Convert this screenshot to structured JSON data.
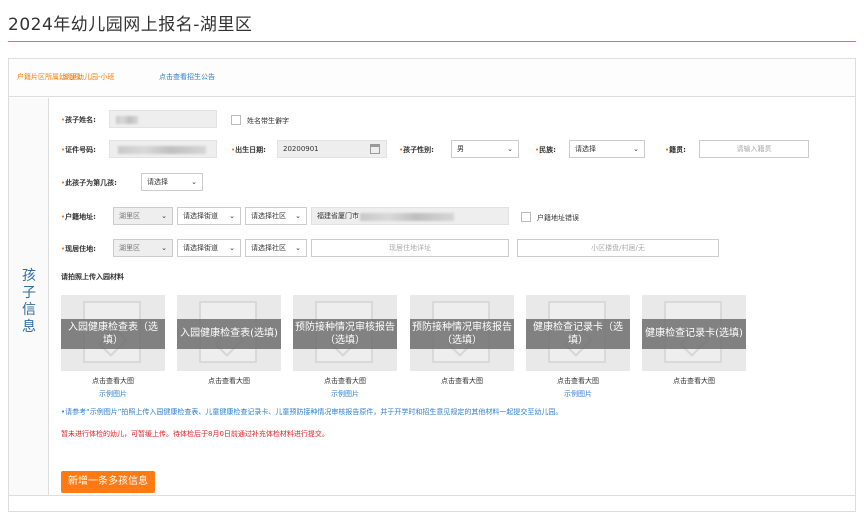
{
  "page": {
    "title": "2024年幼儿园网上报名-湖里区"
  },
  "notice": {
    "kindergarten_label": "户籍片区所属幼儿园:",
    "kindergarten_value": "湖里幼儿园-小班",
    "announcement_link": "点击查看招生公告"
  },
  "section": {
    "title_chars": [
      "孩",
      "子",
      "信",
      "息"
    ]
  },
  "form": {
    "child_name": {
      "label": "孩子姓名:"
    },
    "rare_char": {
      "label": "姓名带生僻字"
    },
    "id_number": {
      "label": "证件号码:"
    },
    "birth": {
      "label": "出生日期:",
      "value": "20200901"
    },
    "gender": {
      "label": "孩子性别:",
      "value": "男"
    },
    "ethnicity": {
      "label": "民族:",
      "value": "请选择"
    },
    "native_place": {
      "label": "籍贯:",
      "placeholder": "请输入籍贯"
    },
    "child_order": {
      "label": "此孩子为第几孩:",
      "value": "请选择"
    },
    "household": {
      "label": "户籍地址:",
      "district": "湖里区",
      "street": "请选择街道",
      "community": "请选择社区",
      "address_prefix": "福建省厦门市",
      "error_label": "户籍地址错误"
    },
    "residence": {
      "label": "现居住地:",
      "district": "湖里区",
      "street": "请选择街道",
      "community": "请选择社区",
      "detail_placeholder": "现居住地详址",
      "building_placeholder": "小区楼盘/村居/无"
    }
  },
  "uploads": {
    "title": "请拍照上传入园材料",
    "tiles": [
      {
        "line1": "入园健康检查表（选",
        "line2": "填）",
        "caption": "点击查看大图",
        "example": ""
      },
      {
        "line1": "入园健康检查表(选填)",
        "line2": "",
        "caption": "点击查看大图",
        "example": "示例图片"
      },
      {
        "line1": "预防接种情况审核报告",
        "line2": "（选填）",
        "caption": "点击查看大图",
        "example": "示例图片"
      },
      {
        "line1": "预防接种情况审核报告",
        "line2": "（选填）",
        "caption": "点击查看大图",
        "example": ""
      },
      {
        "line1": "健康检查记录卡（选",
        "line2": "填）",
        "caption": "点击查看大图",
        "example": "示例图片"
      },
      {
        "line1": "健康检查记录卡(选填)",
        "line2": "",
        "caption": "点击查看大图",
        "example": ""
      }
    ]
  },
  "notes": {
    "blue": "•请参考“示例图片”拍照上传入园健康检查表、儿童健康检查记录卡、儿童预防接种情况审核报告原件，并于开学时和招生意见规定的其他材料一起提交至幼儿园。",
    "red": "暂未进行体检的幼儿，可暂缓上传。待体检后于8月0日前通过补充体检材料进行提交。"
  },
  "actions": {
    "add_child": "新增一条多孩信息"
  },
  "colors": {
    "accent": "#ff7a12",
    "link": "#2c7fd0",
    "rule": "#46a6e0",
    "alert": "#e02020"
  }
}
